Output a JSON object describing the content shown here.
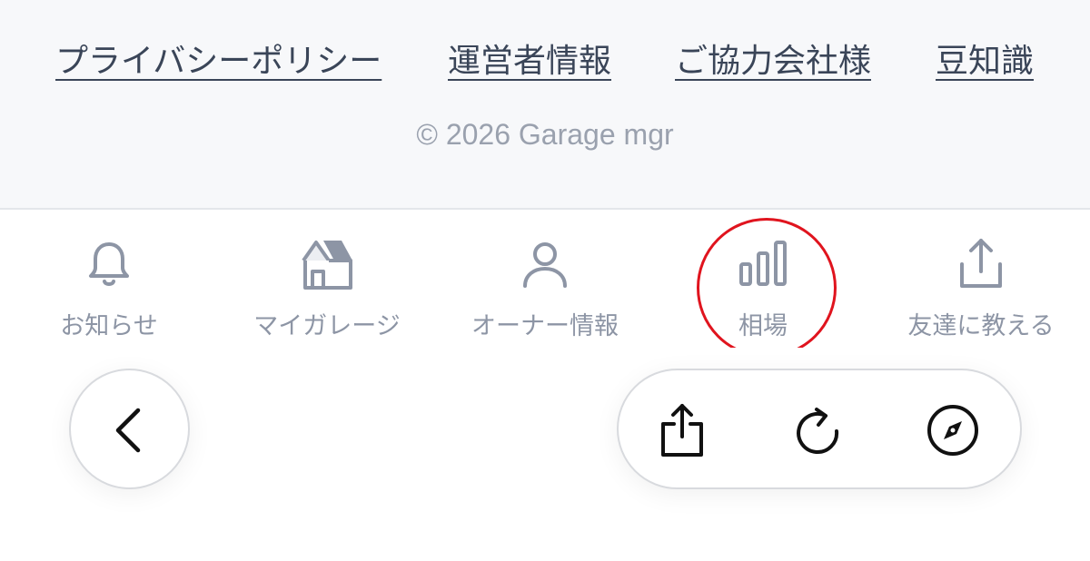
{
  "footer": {
    "links": [
      {
        "label": "プライバシーポリシー"
      },
      {
        "label": "運営者情報"
      },
      {
        "label": "ご協力会社様"
      },
      {
        "label": "豆知識"
      }
    ],
    "copyright": "© 2026 Garage mgr"
  },
  "tabbar": {
    "tabs": [
      {
        "label": "お知らせ",
        "icon": "bell-icon"
      },
      {
        "label": "マイガレージ",
        "icon": "house-icon"
      },
      {
        "label": "オーナー情報",
        "icon": "user-icon"
      },
      {
        "label": "相場",
        "icon": "bar-chart-icon",
        "highlighted": true
      },
      {
        "label": "友達に教える",
        "icon": "share-icon"
      }
    ],
    "highlight_color": "#e0141e",
    "icon_color": "#8d95a5"
  },
  "browser_toolbar": {
    "back_icon": "chevron-left-icon",
    "actions": [
      {
        "icon": "share-icon"
      },
      {
        "icon": "reload-icon"
      },
      {
        "icon": "compass-icon"
      }
    ]
  }
}
